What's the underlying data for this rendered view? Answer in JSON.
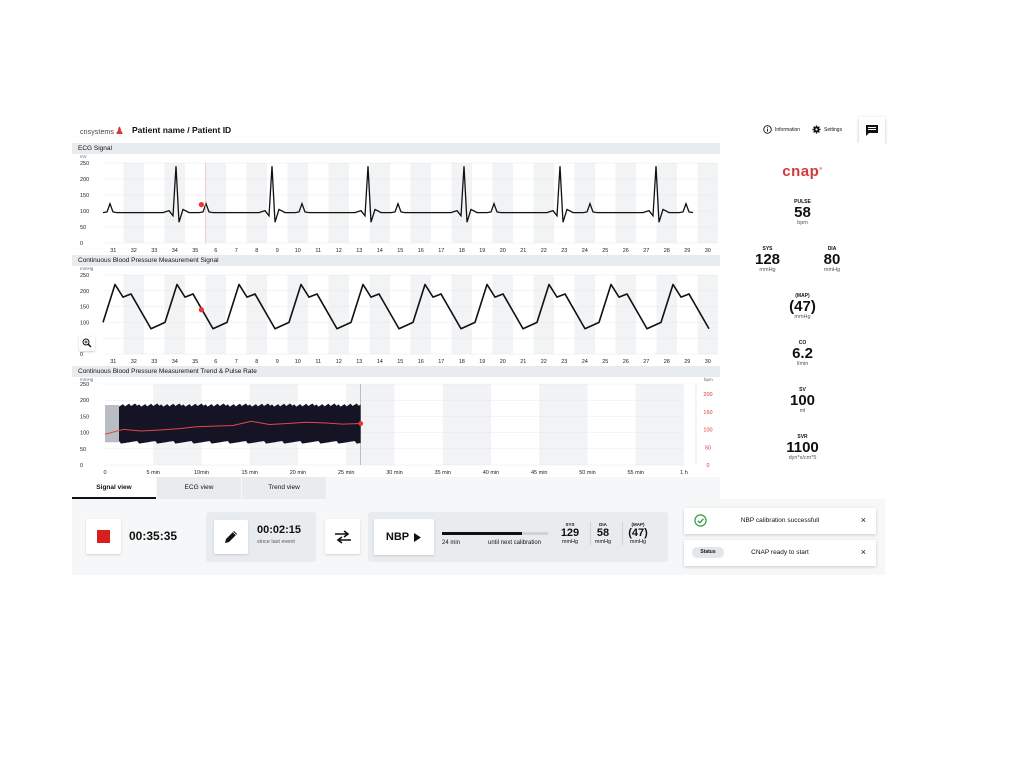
{
  "header": {
    "logo_text": "cnsystems",
    "patient": "Patient name / Patient ID",
    "information_label": "Information",
    "settings_label": "Settings"
  },
  "ecg": {
    "title": "ECG Signal",
    "unit": "mV",
    "y_ticks": [
      "250",
      "200",
      "150",
      "100",
      "50",
      "0"
    ],
    "x_ticks": [
      "31",
      "32",
      "33",
      "34",
      "35",
      "6",
      "7",
      "8",
      "9",
      "10",
      "11",
      "12",
      "13",
      "14",
      "15",
      "16",
      "17",
      "18",
      "19",
      "20",
      "21",
      "22",
      "23",
      "24",
      "25",
      "26",
      "27",
      "28",
      "29",
      "30"
    ]
  },
  "cbp": {
    "title": "Continuous Blood Pressure Measurement Signal",
    "unit": "mmHg",
    "y_ticks": [
      "250",
      "200",
      "150",
      "100",
      "50",
      "0"
    ],
    "x_ticks": [
      "31",
      "32",
      "33",
      "34",
      "35",
      "6",
      "7",
      "8",
      "9",
      "10",
      "11",
      "12",
      "13",
      "14",
      "15",
      "16",
      "17",
      "18",
      "19",
      "20",
      "21",
      "22",
      "23",
      "24",
      "25",
      "26",
      "27",
      "28",
      "29",
      "30"
    ]
  },
  "trend": {
    "title": "Continuous Blood Pressure Measurement Trend & Pulse Rate",
    "unit_left": "mmHg",
    "unit_right": "bpm",
    "y_ticks": [
      "250",
      "200",
      "150",
      "100",
      "50",
      "0"
    ],
    "y_ticks_right": [
      "200",
      "150",
      "100",
      "50",
      "0"
    ],
    "x_ticks": [
      "0",
      "5 min",
      "10min",
      "15 min",
      "20 min",
      "25 min",
      "30 min",
      "35 min",
      "40 min",
      "45 min",
      "50 min",
      "55 min",
      "1 h"
    ]
  },
  "chart_data": [
    {
      "type": "line",
      "title": "ECG Signal",
      "ylabel": "mV",
      "ylim": [
        0,
        250
      ],
      "categories": [
        "31",
        "32",
        "33",
        "34",
        "35",
        "6",
        "7",
        "8",
        "9",
        "10",
        "11",
        "12",
        "13",
        "14",
        "15",
        "16",
        "17",
        "18",
        "19",
        "20",
        "21",
        "22",
        "23",
        "24",
        "25",
        "26",
        "27",
        "28",
        "29",
        "30"
      ],
      "series": [
        {
          "beat_starts": [
            31.3,
            35.8,
            10.3,
            15.5,
            20.1,
            25.2,
            30.0
          ],
          "r_peak": 240,
          "baseline": 95
        }
      ],
      "grid": true
    },
    {
      "type": "line",
      "title": "Continuous Blood Pressure Measurement Signal",
      "ylabel": "mmHg",
      "ylim": [
        0,
        250
      ],
      "categories": [
        "31",
        "32",
        "33",
        "34",
        "35",
        "6",
        "7",
        "8",
        "9",
        "10",
        "11",
        "12",
        "13",
        "14",
        "15",
        "16",
        "17",
        "18",
        "19",
        "20",
        "21",
        "22",
        "23",
        "24",
        "25",
        "26",
        "27",
        "28",
        "29",
        "30"
      ],
      "series": [
        {
          "systolic": 220,
          "diastolic": 80
        }
      ],
      "grid": true
    },
    {
      "type": "area",
      "title": "Continuous Blood Pressure Measurement Trend & Pulse Rate",
      "ylabel": "mmHg",
      "ylim": [
        0,
        250
      ],
      "y2label": "bpm",
      "y2lim": [
        0,
        200
      ],
      "x": [
        "0",
        "5 min",
        "10min",
        "15 min",
        "20 min",
        "25 min",
        "30 min",
        "35 min",
        "40 min",
        "45 min",
        "50 min",
        "55 min",
        "1 h"
      ],
      "series": [
        {
          "band_high": 185,
          "band_low": 70,
          "from_min": 0,
          "to_min": 26.5
        },
        {
          "pulse": [
            95,
            110,
            105,
            108,
            112,
            118,
            120,
            122,
            135,
            125,
            128,
            132,
            130,
            126,
            128
          ],
          "from_min": 0,
          "to_min": 26.5
        }
      ],
      "grid": true
    }
  ],
  "sidebar": {
    "logo": "cnap",
    "pulse": {
      "label": "PULSE",
      "value": "58",
      "unit": "bpm"
    },
    "sys": {
      "label": "SYS",
      "value": "128",
      "unit": "mmHg"
    },
    "dia": {
      "label": "DIA",
      "value": "80",
      "unit": "mmHg"
    },
    "map": {
      "label": "(MAP)",
      "value": "(47)",
      "unit": "mmHg"
    },
    "co": {
      "label": "CO",
      "value": "6.2",
      "unit": "l/min"
    },
    "sv": {
      "label": "SV",
      "value": "100",
      "unit": "ml"
    },
    "svr": {
      "label": "SVR",
      "value": "1100",
      "unit": "dyn*s/cm*5"
    }
  },
  "tabs": [
    {
      "label": "Signal view",
      "active": true
    },
    {
      "label": "ECG view",
      "active": false
    },
    {
      "label": "Trend view",
      "active": false
    }
  ],
  "bottom": {
    "elapsed": "00:35:35",
    "since_event": "00:02:15",
    "since_event_label": "since last event",
    "nbp_label": "NBP",
    "progress_min": "24 min",
    "progress_label": "until next calibration",
    "progress_fraction": 0.75,
    "nbp_sys": {
      "label": "SYS",
      "value": "129",
      "unit": "mmHg"
    },
    "nbp_dia": {
      "label": "DIA",
      "value": "58",
      "unit": "mmHg"
    },
    "nbp_map": {
      "label": "(MAP)",
      "value": "(47)",
      "unit": "mmHg"
    }
  },
  "notifications": [
    {
      "text": "NBP calibration successfull"
    },
    {
      "badge": "Status",
      "text": "CNAP ready to start"
    }
  ],
  "colors": {
    "accent": "#d23a3a",
    "dark": "#111111",
    "panel": "#e9ecef"
  }
}
